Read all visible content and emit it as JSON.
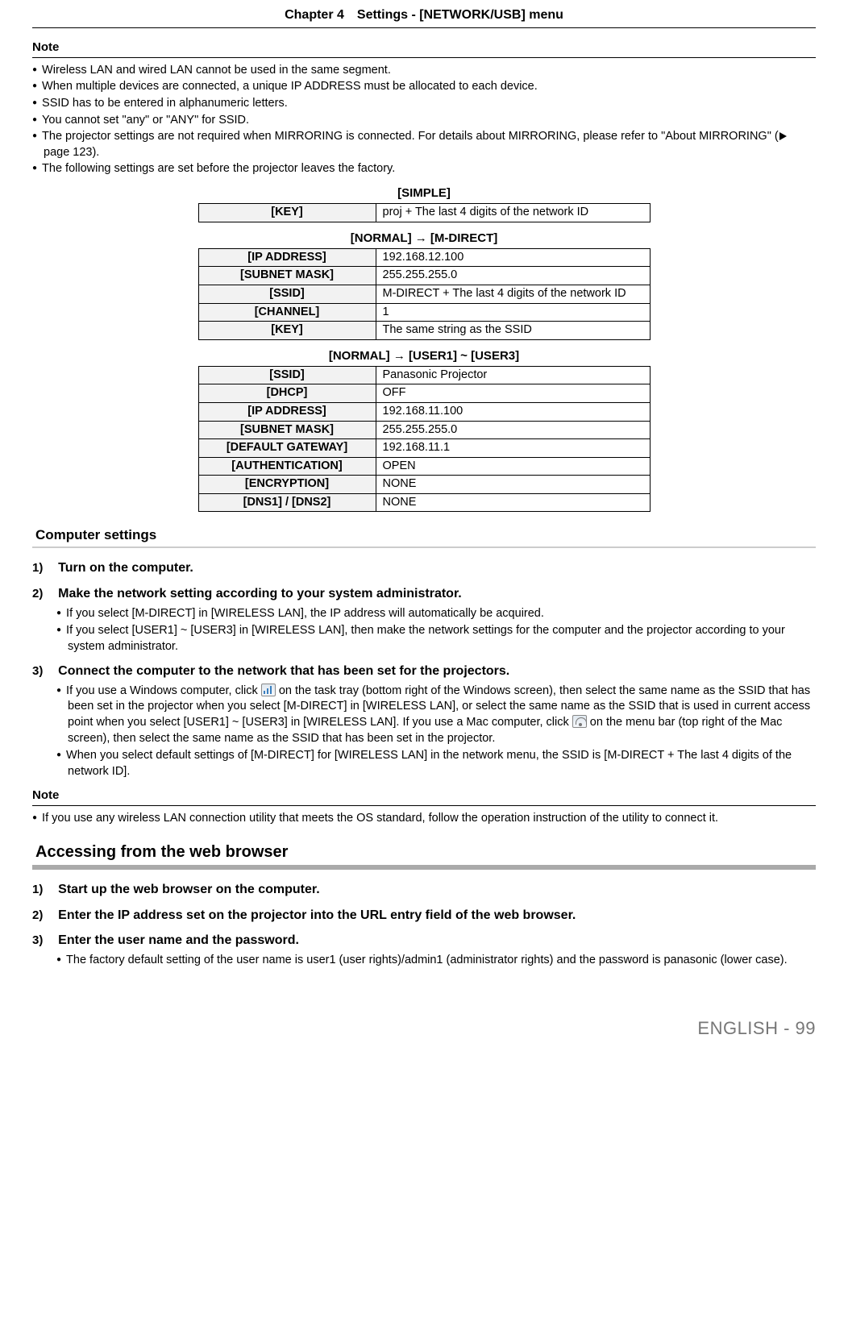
{
  "header": "Chapter 4　Settings - [NETWORK/USB] menu",
  "note_label": "Note",
  "notes1": {
    "i0": "Wireless LAN and wired LAN cannot be used in the same segment.",
    "i1": "When multiple devices are connected, a unique IP ADDRESS must be allocated to each device.",
    "i2": "SSID has to be entered in alphanumeric letters.",
    "i3": "You cannot set \"any\" or \"ANY\" for SSID.",
    "i4a": "The projector settings are not required when MIRRORING is connected. For details about MIRRORING, please refer to \"About MIRRORING\" (",
    "i4b": " page 123).",
    "i5": "The following settings are set before the projector leaves the factory."
  },
  "table_simple": {
    "title": "[SIMPLE]",
    "rows": {
      "r0": {
        "k": "[KEY]",
        "v": "proj + The last 4 digits of the network ID"
      }
    }
  },
  "table_mdirect": {
    "title": "[NORMAL] → [M-DIRECT]",
    "rows": {
      "r0": {
        "k": "[IP ADDRESS]",
        "v": "192.168.12.100"
      },
      "r1": {
        "k": "[SUBNET MASK]",
        "v": "255.255.255.0"
      },
      "r2": {
        "k": "[SSID]",
        "v": "M-DIRECT + The last 4 digits of the network ID"
      },
      "r3": {
        "k": "[CHANNEL]",
        "v": "1"
      },
      "r4": {
        "k": "[KEY]",
        "v": "The same string as the SSID"
      }
    }
  },
  "table_user": {
    "title": "[NORMAL] → [USER1] ~ [USER3]",
    "rows": {
      "r0": {
        "k": "[SSID]",
        "v": "Panasonic Projector"
      },
      "r1": {
        "k": "[DHCP]",
        "v": "OFF"
      },
      "r2": {
        "k": "[IP ADDRESS]",
        "v": "192.168.11.100"
      },
      "r3": {
        "k": "[SUBNET MASK]",
        "v": "255.255.255.0"
      },
      "r4": {
        "k": "[DEFAULT GATEWAY]",
        "v": "192.168.11.1"
      },
      "r5": {
        "k": "[AUTHENTICATION]",
        "v": "OPEN"
      },
      "r6": {
        "k": "[ENCRYPTION]",
        "v": "NONE"
      },
      "r7": {
        "k": "[DNS1] / [DNS2]",
        "v": "NONE"
      }
    }
  },
  "computer_settings_heading": "Computer settings",
  "steps_a": {
    "s1": {
      "n": "1)",
      "t": "Turn on the computer."
    },
    "s2": {
      "n": "2)",
      "t": "Make the network setting according to your system administrator.",
      "b0": "If you select [M-DIRECT] in [WIRELESS LAN], the IP address will automatically be acquired.",
      "b1": "If you select [USER1] ~ [USER3] in [WIRELESS LAN], then make the network settings for the computer and the projector according to your system administrator."
    },
    "s3": {
      "n": "3)",
      "t": "Connect the computer to the network that has been set for the projectors.",
      "b0a": "If you use a Windows computer, click ",
      "b0b": " on the task tray (bottom right of the Windows screen), then select the same name as the SSID that has been set in the projector when you select [M-DIRECT] in [WIRELESS LAN], or select the same name as the SSID that is used in current access point when you select [USER1] ~ [USER3] in [WIRELESS LAN]. If you use a Mac computer, click ",
      "b0c": " on the menu bar (top right of the Mac screen), then select the same name as the SSID that has been set in the projector.",
      "b1": "When you select default settings of [M-DIRECT] for [WIRELESS LAN] in the network menu, the SSID is [M-DIRECT + The last 4 digits of the network ID]."
    }
  },
  "notes2": {
    "i0": "If you use any wireless LAN connection utility that meets the OS standard, follow the operation instruction of the utility to connect it."
  },
  "accessing_heading": "Accessing from the web browser",
  "steps_b": {
    "s1": {
      "n": "1)",
      "t": "Start up the web browser on the computer."
    },
    "s2": {
      "n": "2)",
      "t": "Enter the IP address set on the projector into the URL entry field of the web browser."
    },
    "s3": {
      "n": "3)",
      "t": "Enter the user name and the password.",
      "b0": "The factory default setting of the user name is user1 (user rights)/admin1 (administrator rights) and the password is panasonic (lower case)."
    }
  },
  "footer": "ENGLISH - 99"
}
